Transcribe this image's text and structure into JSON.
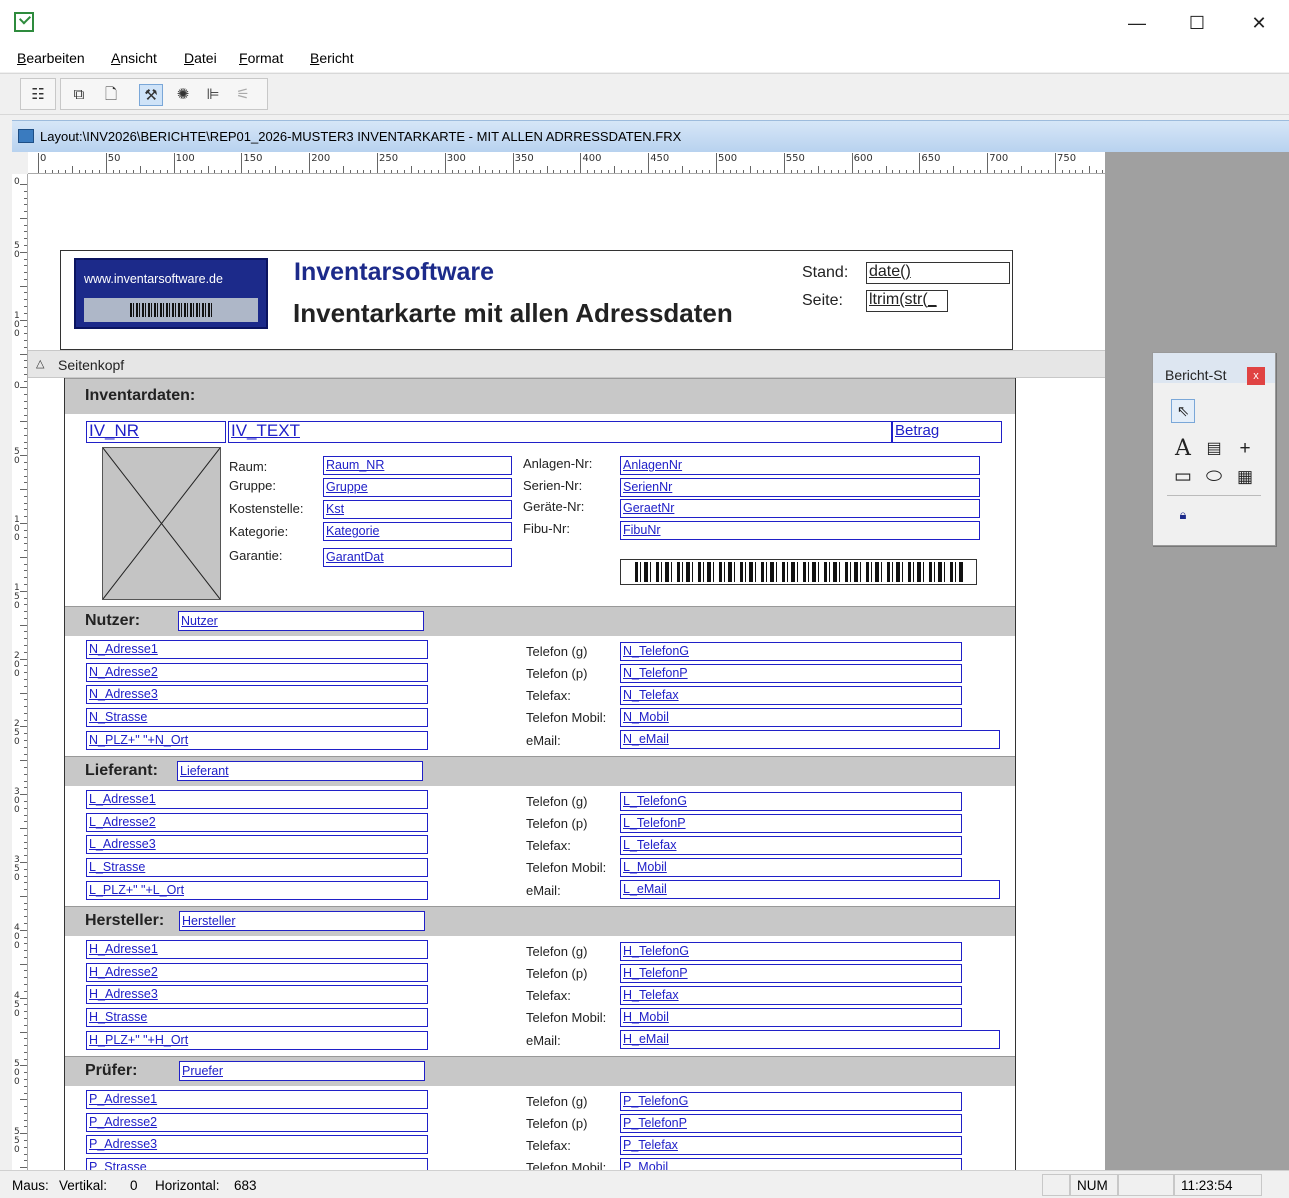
{
  "window": {
    "minimize": "—",
    "maximize": "☐",
    "close": "✕"
  },
  "menu": [
    "Bearbeiten",
    "Ansicht",
    "Datei",
    "Format",
    "Bericht"
  ],
  "toolbar": {
    "icons": [
      "field-list-icon",
      "data-env-icon",
      "page-setup-icon",
      "tools-icon",
      "color-palette-icon",
      "layout-icon",
      "align-icon"
    ]
  },
  "doc": {
    "title": "Layout:\\INV2026\\BERICHTE\\REP01_2026-MUSTER3 INVENTARKARTE - MIT ALLEN ADRRESSDATEN.FRX"
  },
  "ruler": {
    "top_labels": [
      "0",
      "50",
      "100",
      "150",
      "200",
      "250",
      "300",
      "350",
      "400",
      "450",
      "500",
      "550",
      "600",
      "650",
      "700",
      "750"
    ],
    "left_labels": [
      "0",
      "5 0",
      "1 0 0",
      "0",
      "5 0",
      "1 0 0",
      "1 5 0",
      "2 0 0",
      "2 5 0",
      "3 0 0",
      "3 5 0",
      "4 0 0",
      "4 5 0",
      "5 0 0",
      "5 5 0"
    ]
  },
  "header": {
    "logo_url": "www.inventarsoftware.de",
    "title": "Inventarsoftware",
    "subtitle": "Inventarkarte mit allen Adressdaten",
    "stand_label": "Stand:",
    "stand_field": "date()",
    "seite_label": "Seite:",
    "seite_field": "ltrim(str(_"
  },
  "band_seitenkopf": "Seitenkopf",
  "inventar": {
    "heading": "Inventardaten:",
    "iv_nr": "IV_NR",
    "iv_text": "IV_TEXT",
    "betrag": "Betrag",
    "left_labels": [
      "Raum:",
      "Gruppe:",
      "Kostenstelle:",
      "Kategorie:",
      "Garantie:"
    ],
    "left_fields": [
      "Raum_NR",
      "Gruppe",
      "Kst",
      "Kategorie",
      "GarantDat"
    ],
    "right_labels": [
      "Anlagen-Nr:",
      "Serien-Nr:",
      "Geräte-Nr:",
      "Fibu-Nr:"
    ],
    "right_fields": [
      "AnlagenNr",
      "SerienNr",
      "GeraetNr",
      "FibuNr"
    ]
  },
  "sections": [
    {
      "heading": "Nutzer:",
      "main_field": "Nutzer",
      "address": [
        "N_Adresse1",
        "N_Adresse2",
        "N_Adresse3",
        "N_Strasse",
        "N_PLZ+\" \"+N_Ort"
      ],
      "contact_labels": [
        "Telefon (g)",
        "Telefon (p)",
        "Telefax:",
        "Telefon Mobil:",
        "eMail:"
      ],
      "contact_fields": [
        "N_TelefonG",
        "N_TelefonP",
        "N_Telefax",
        "N_Mobil",
        "N_eMail"
      ]
    },
    {
      "heading": "Lieferant:",
      "main_field": "Lieferant",
      "address": [
        "L_Adresse1",
        "L_Adresse2",
        "L_Adresse3",
        "L_Strasse",
        "L_PLZ+\" \"+L_Ort"
      ],
      "contact_labels": [
        "Telefon (g)",
        "Telefon (p)",
        "Telefax:",
        "Telefon Mobil:",
        "eMail:"
      ],
      "contact_fields": [
        "L_TelefonG",
        "L_TelefonP",
        "L_Telefax",
        "L_Mobil",
        "L_eMail"
      ]
    },
    {
      "heading": "Hersteller:",
      "main_field": "Hersteller",
      "address": [
        "H_Adresse1",
        "H_Adresse2",
        "H_Adresse3",
        "H_Strasse",
        "H_PLZ+\" \"+H_Ort"
      ],
      "contact_labels": [
        "Telefon (g)",
        "Telefon (p)",
        "Telefax:",
        "Telefon Mobil:",
        "eMail:"
      ],
      "contact_fields": [
        "H_TelefonG",
        "H_TelefonP",
        "H_Telefax",
        "H_Mobil",
        "H_eMail"
      ]
    },
    {
      "heading": "Prüfer:",
      "main_field": "Pruefer",
      "address": [
        "P_Adresse1",
        "P_Adresse2",
        "P_Adresse3",
        "P_Strasse",
        ""
      ],
      "contact_labels": [
        "Telefon (g)",
        "Telefon (p)",
        "Telefax:",
        "Telefon Mobil:",
        ""
      ],
      "contact_fields": [
        "P_TelefonG",
        "P_TelefonP",
        "P_Telefax",
        "P_Mobil",
        ""
      ]
    }
  ],
  "palette": {
    "title": "Bericht-St",
    "close": "x",
    "tools": [
      "pointer-icon",
      "label-tool-icon",
      "field-tool-icon",
      "line-tool-icon",
      "rectangle-tool-icon",
      "rounded-rect-tool-icon",
      "picture-tool-icon",
      "lock-icon"
    ]
  },
  "status": {
    "maus_label": "Maus:",
    "vertikal_label": "Vertikal:",
    "vertikal_value": "0",
    "horizontal_label": "Horizontal:",
    "horizontal_value": "683",
    "num": "NUM",
    "time": "11:23:54"
  }
}
